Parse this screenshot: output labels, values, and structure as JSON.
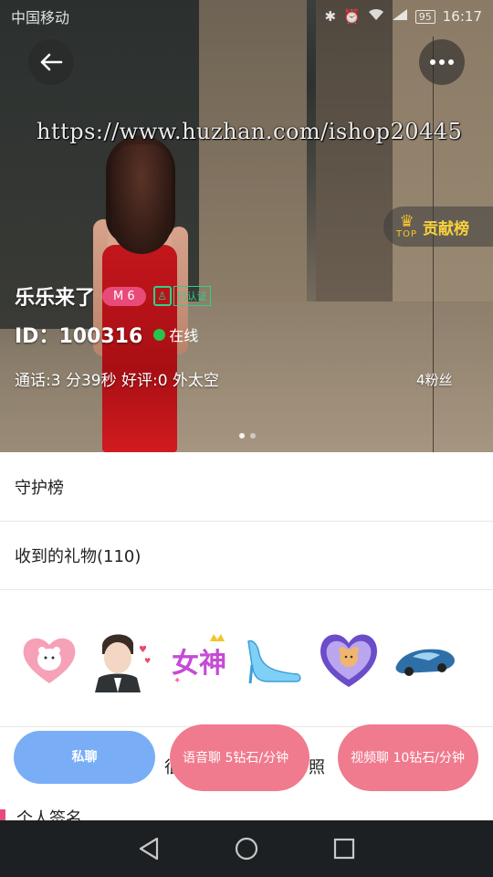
{
  "status_bar": {
    "carrier": "中国移动",
    "battery": "95",
    "time": "16:17"
  },
  "hero": {
    "watermark": "https://www.huzhan.com/ishop20445",
    "contribution": {
      "top_text": "TOP",
      "label": "贡献榜"
    },
    "name": "乐乐来了",
    "level": "M 6",
    "auth_text": "已认证",
    "id_text": "ID：100316",
    "online_text": "在线",
    "stats_text": "通话:3 分39秒 好评:0 外太空",
    "fans_text": "4粉丝"
  },
  "sections": {
    "guard": "守护榜",
    "gifts_title": "收到的礼物(110)"
  },
  "gifts": [
    "bear-heart-icon",
    "boy-kiss-icon",
    "goddess-icon",
    "glass-slipper-icon",
    "bear-flower-heart-icon",
    "sports-car-icon"
  ],
  "tabs_hint": {
    "left": "很",
    "right": "照"
  },
  "actions": {
    "private_chat": "私聊",
    "voice_chat": "语音聊 5钻石/分钟",
    "video_chat": "视频聊 10钻石/分钟"
  },
  "album": {
    "label": "个人签名"
  },
  "colors": {
    "accent_pink": "#f07a8e",
    "private_blue": "#79aef7",
    "level_pink": "#e84a7a",
    "online_green": "#29c24a"
  }
}
